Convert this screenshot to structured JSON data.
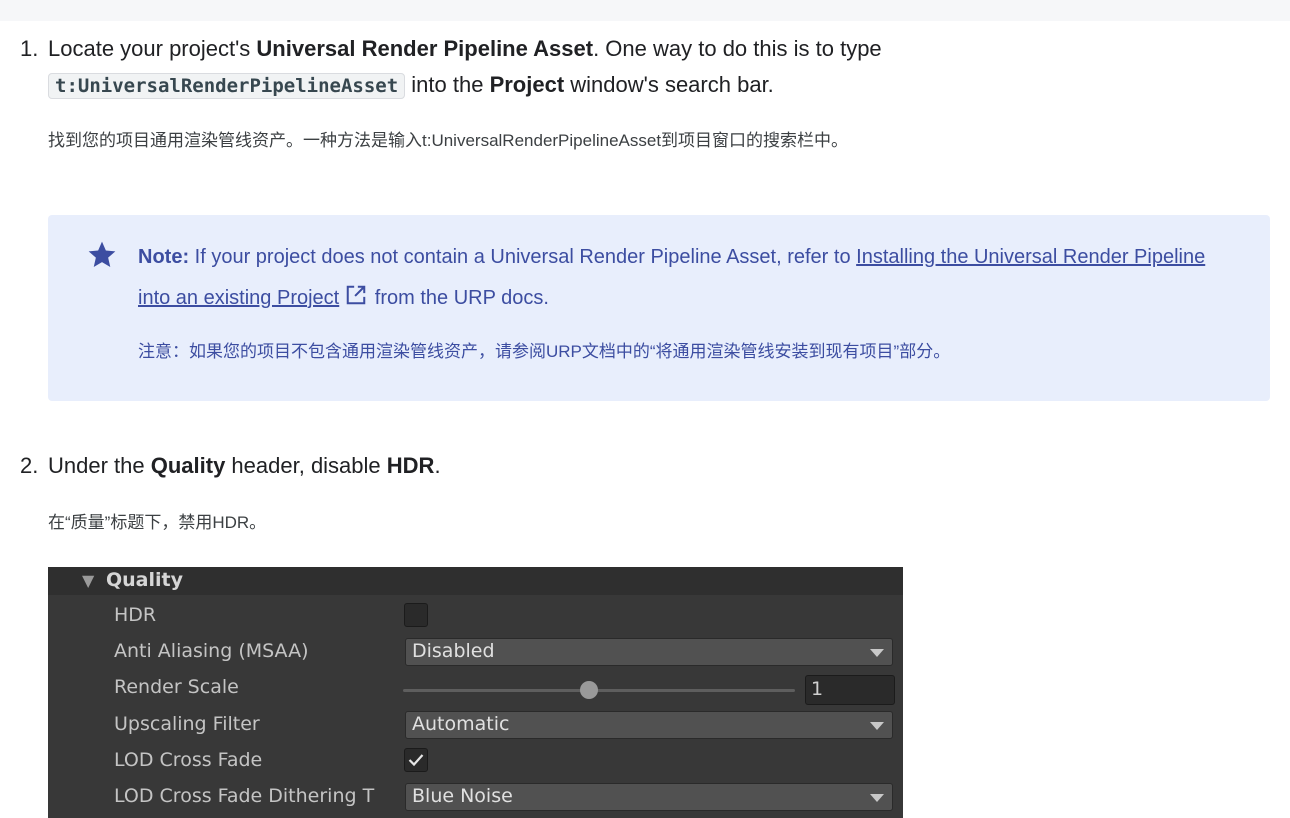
{
  "step1": {
    "number": "1.",
    "part1": "Locate your project's ",
    "bold1": "Universal Render Pipeline Asset",
    "part2": ". One way to do this is to type",
    "code": "t:UniversalRenderPipelineAsset",
    "part3": " into the ",
    "bold2": "Project",
    "part4": " window's search bar.",
    "translation": "找到您的项目通用渲染管线资产。一种方法是输入t:UniversalRenderPipelineAsset到项目窗口的搜索栏中。"
  },
  "note": {
    "icon": "star-icon",
    "label": "Note:",
    "text1": " If your project does not contain a Universal Render Pipeline Asset, refer to ",
    "link": "Installing the Universal Render Pipeline into an existing Project",
    "link_icon": "external-link-icon",
    "text2": "from the URP docs.",
    "translation": "注意：如果您的项目不包含通用渲染管线资产，请参阅URP文档中的“将通用渲染管线安装到现有项目”部分。",
    "background": "#e8eefc",
    "accent": "#3c4da1"
  },
  "step2": {
    "number": "2.",
    "part1": "Under the ",
    "bold1": "Quality",
    "part2": " header, disable ",
    "bold2": "HDR",
    "part3": ".",
    "translation": "在“质量”标题下，禁用HDR。"
  },
  "panel": {
    "header": "Quality",
    "rows": {
      "hdr": {
        "label": "HDR",
        "checked": false
      },
      "msaa": {
        "label": "Anti Aliasing (MSAA)",
        "value": "Disabled"
      },
      "render_scale": {
        "label": "Render Scale",
        "value": "1",
        "slider_fraction": 0.45
      },
      "upscaling": {
        "label": "Upscaling Filter",
        "value": "Automatic"
      },
      "lod_cross_fade": {
        "label": "LOD Cross Fade",
        "checked": true
      },
      "lod_dither": {
        "label": "LOD Cross Fade Dithering T",
        "value": "Blue Noise"
      }
    }
  }
}
